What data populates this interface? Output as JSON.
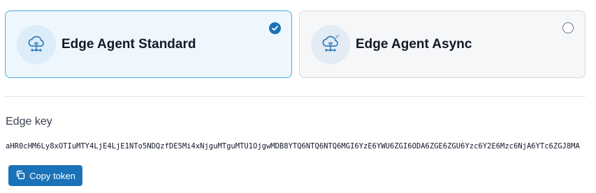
{
  "options": [
    {
      "label": "Edge Agent Standard",
      "selected": true,
      "icon": "cloud-network-icon"
    },
    {
      "label": "Edge Agent Async",
      "selected": false,
      "icon": "cloud-network-async-icon"
    }
  ],
  "edge_key": {
    "label": "Edge key",
    "value": "aHR0cHM6Ly8xOTIuMTY4LjE4LjE1NTo5NDQzfDE5Mi4xNjguMTguMTU1OjgwMDB8YTQ6NTQ6NTQ6MGI6YzE6YWU6ZGI6ODA6ZGE6ZGU6Yzc6Y2E6Mzc6NjA6YTc6ZGJ8MA"
  },
  "copy_button": {
    "label": "Copy token",
    "icon": "copy-icon"
  },
  "colors": {
    "accent": "#1a73b8",
    "selected_border": "#49a9de",
    "selected_bg": "#eef7fd"
  }
}
